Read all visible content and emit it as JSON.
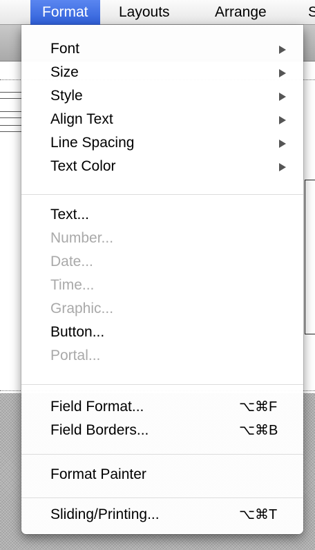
{
  "menubar": {
    "prev_fragment": ":",
    "active_menu": "Format",
    "items": [
      {
        "label": "Layouts"
      },
      {
        "label": "Arrange"
      }
    ],
    "next_fragment": "S",
    "highlight_color": "#3a6ae0"
  },
  "format_menu": {
    "groups": [
      [
        {
          "label": "Font",
          "submenu": true,
          "enabled": true
        },
        {
          "label": "Size",
          "submenu": true,
          "enabled": true
        },
        {
          "label": "Style",
          "submenu": true,
          "enabled": true
        },
        {
          "label": "Align Text",
          "submenu": true,
          "enabled": true
        },
        {
          "label": "Line Spacing",
          "submenu": true,
          "enabled": true
        },
        {
          "label": "Text Color",
          "submenu": true,
          "enabled": true
        }
      ],
      [
        {
          "label": "Text...",
          "enabled": true
        },
        {
          "label": "Number...",
          "enabled": false
        },
        {
          "label": "Date...",
          "enabled": false
        },
        {
          "label": "Time...",
          "enabled": false
        },
        {
          "label": "Graphic...",
          "enabled": false
        },
        {
          "label": "Button...",
          "enabled": true
        },
        {
          "label": "Portal...",
          "enabled": false
        }
      ],
      [
        {
          "label": "Field Format...",
          "shortcut": "⌥⌘F",
          "enabled": true
        },
        {
          "label": "Field Borders...",
          "shortcut": "⌥⌘B",
          "enabled": true
        }
      ],
      [
        {
          "label": "Format Painter",
          "enabled": true
        }
      ],
      [
        {
          "label": "Sliding/Printing...",
          "shortcut": "⌥⌘T",
          "enabled": true
        }
      ]
    ]
  }
}
